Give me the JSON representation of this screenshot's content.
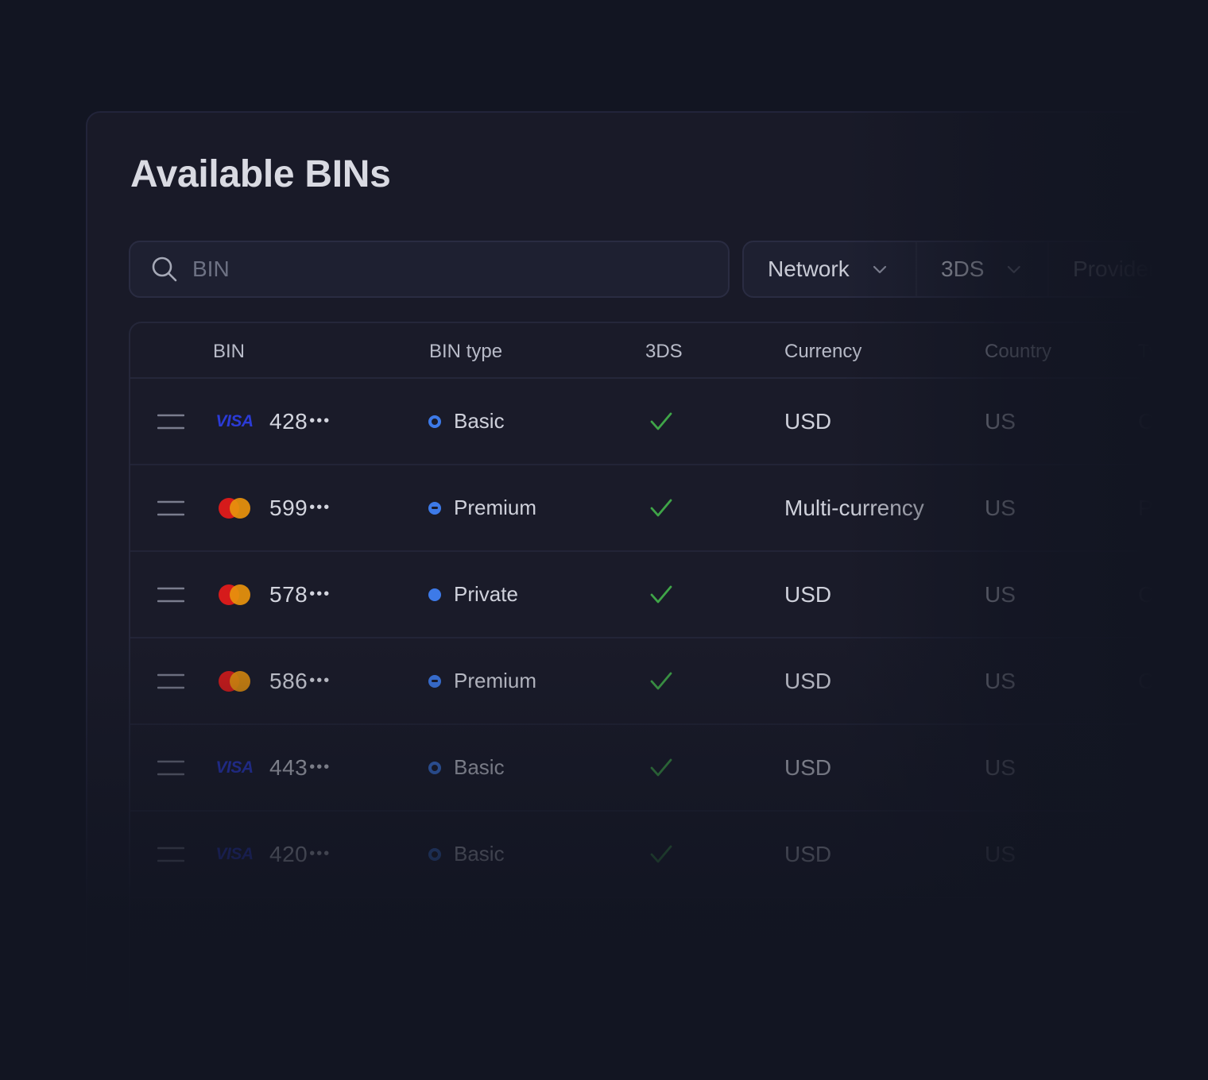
{
  "page": {
    "title": "Available BINs"
  },
  "search": {
    "placeholder": "BIN",
    "icon": "search-icon"
  },
  "filters": [
    {
      "label": "Network",
      "icon": "chevron-down-icon"
    },
    {
      "label": "3DS",
      "icon": "chevron-down-icon"
    },
    {
      "label": "Provider"
    }
  ],
  "table": {
    "headers": [
      "BIN",
      "BIN type",
      "3DS",
      "Currency",
      "Country",
      "Typ"
    ],
    "rows": [
      {
        "network": "visa",
        "network_label": "VISA",
        "bin": "428",
        "bin_type": "Basic",
        "three_ds": true,
        "currency": "USD",
        "country": "US",
        "kind": "Cred"
      },
      {
        "network": "mastercard",
        "network_label": "",
        "bin": "599",
        "bin_type": "Premium",
        "three_ds": true,
        "currency": "Multi-currency",
        "country": "US",
        "kind": "Prep"
      },
      {
        "network": "mastercard",
        "network_label": "",
        "bin": "578",
        "bin_type": "Private",
        "three_ds": true,
        "currency": "USD",
        "country": "US",
        "kind": "Cre"
      },
      {
        "network": "mastercard",
        "network_label": "",
        "bin": "586",
        "bin_type": "Premium",
        "three_ds": true,
        "currency": "USD",
        "country": "US",
        "kind": "Cr"
      },
      {
        "network": "visa",
        "network_label": "VISA",
        "bin": "443",
        "bin_type": "Basic",
        "three_ds": true,
        "currency": "USD",
        "country": "US",
        "kind": ""
      },
      {
        "network": "visa",
        "network_label": "VISA",
        "bin": "420",
        "bin_type": "Basic",
        "three_ds": true,
        "currency": "USD",
        "country": "US",
        "kind": ""
      }
    ],
    "masked_suffix": "•••"
  },
  "colors": {
    "background": "#121522",
    "card": "#191a28",
    "accent_blue": "#3d7ae8",
    "check_green": "#3fa548",
    "visa_blue": "#2b3bd6",
    "mc_red": "#d61b1b",
    "mc_orange": "#e8920c"
  }
}
